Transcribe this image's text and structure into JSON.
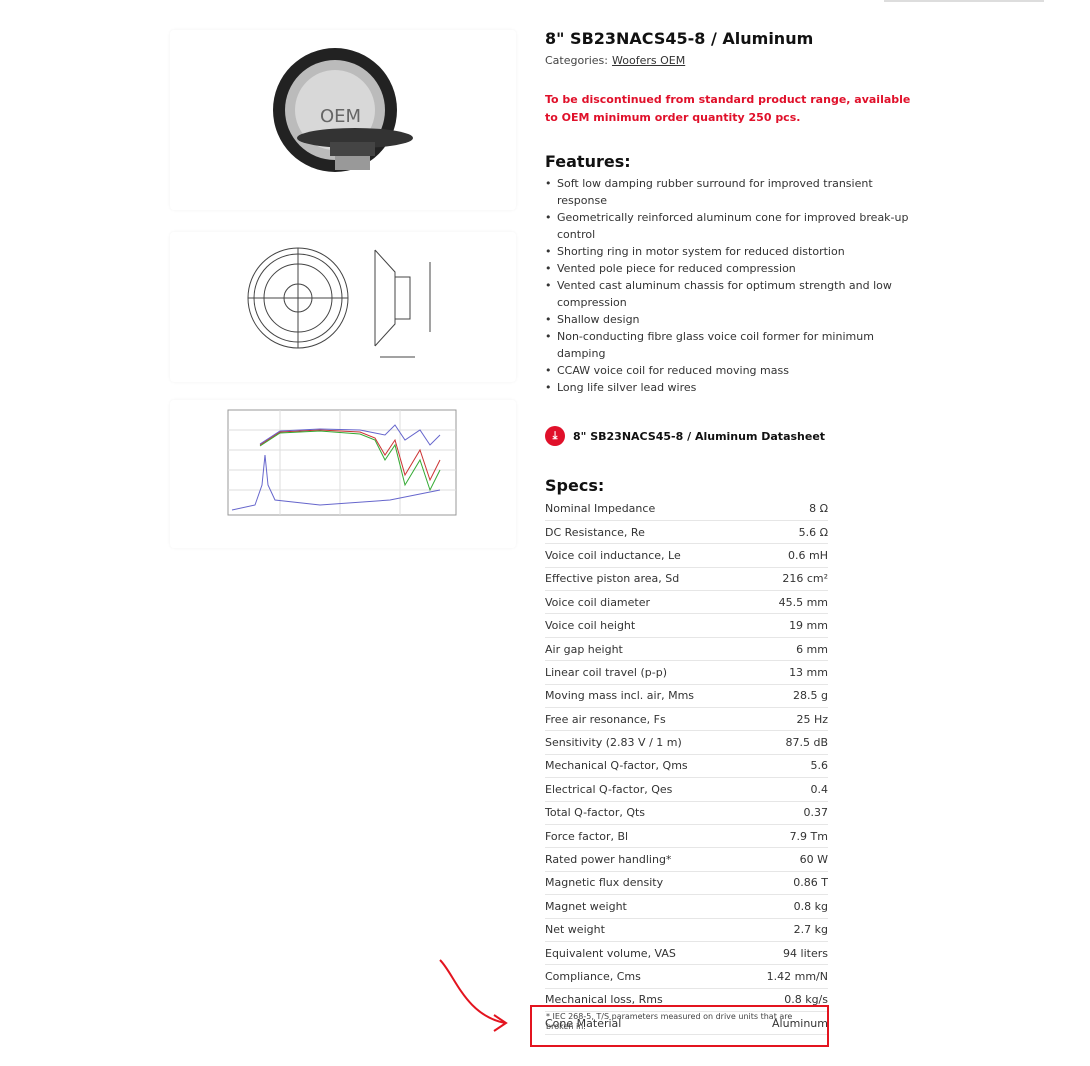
{
  "product": {
    "title": "8\" SB23NACS45-8 / Aluminum",
    "categories_label": "Categories:",
    "category": "Woofers OEM",
    "notice": "To be discontinued from standard product range, available to OEM minimum order quantity 250 pcs.",
    "image_badge": "OEM"
  },
  "features": {
    "heading": "Features:",
    "items": [
      "Soft low damping rubber surround for improved transient response",
      "Geometrically reinforced aluminum cone for improved break-up control",
      "Shorting ring in motor system for reduced distortion",
      "Vented pole piece for reduced compression",
      "Vented cast aluminum chassis for optimum strength and low compression",
      "Shallow design",
      "Non-conducting fibre glass voice coil former for minimum damping",
      "CCAW voice coil for reduced moving mass",
      "Long life silver lead wires"
    ]
  },
  "datasheet": {
    "label": "8\" SB23NACS45-8 / Aluminum Datasheet",
    "icon": "download-icon"
  },
  "specs": {
    "heading": "Specs:",
    "rows": [
      [
        "Nominal Impedance",
        "8 Ω"
      ],
      [
        "DC Resistance, Re",
        "5.6 Ω"
      ],
      [
        "Voice coil inductance, Le",
        "0.6 mH"
      ],
      [
        "Effective piston area, Sd",
        "216 cm²"
      ],
      [
        "Voice coil diameter",
        "45.5 mm"
      ],
      [
        "Voice coil height",
        "19 mm"
      ],
      [
        "Air gap height",
        "6 mm"
      ],
      [
        "Linear coil travel (p-p)",
        "13 mm"
      ],
      [
        "Moving mass incl. air, Mms",
        "28.5 g"
      ],
      [
        "Free air resonance, Fs",
        "25 Hz"
      ],
      [
        "Sensitivity (2.83 V / 1 m)",
        "87.5 dB"
      ],
      [
        "Mechanical Q-factor, Qms",
        "5.6"
      ],
      [
        "Electrical Q-factor, Qes",
        "0.4"
      ],
      [
        "Total Q-factor, Qts",
        "0.37"
      ],
      [
        "Force factor, Bl",
        "7.9 Tm"
      ],
      [
        "Rated power handling*",
        "60 W"
      ],
      [
        "Magnetic flux density",
        "0.86 T"
      ],
      [
        "Magnet weight",
        "0.8 kg"
      ],
      [
        "Net weight",
        "2.7 kg"
      ],
      [
        "Equivalent volume, VAS",
        "94 liters"
      ],
      [
        "Compliance, Cms",
        "1.42 mm/N"
      ],
      [
        "Mechanical loss, Rms",
        "0.8 kg/s"
      ],
      [
        "Cone Material",
        "Aluminum"
      ]
    ],
    "footnote": "* IEC 268-5, T/S parameters measured on drive units that are broken in."
  },
  "colors": {
    "accent": "#e0102a",
    "annotation": "#e3141f"
  }
}
